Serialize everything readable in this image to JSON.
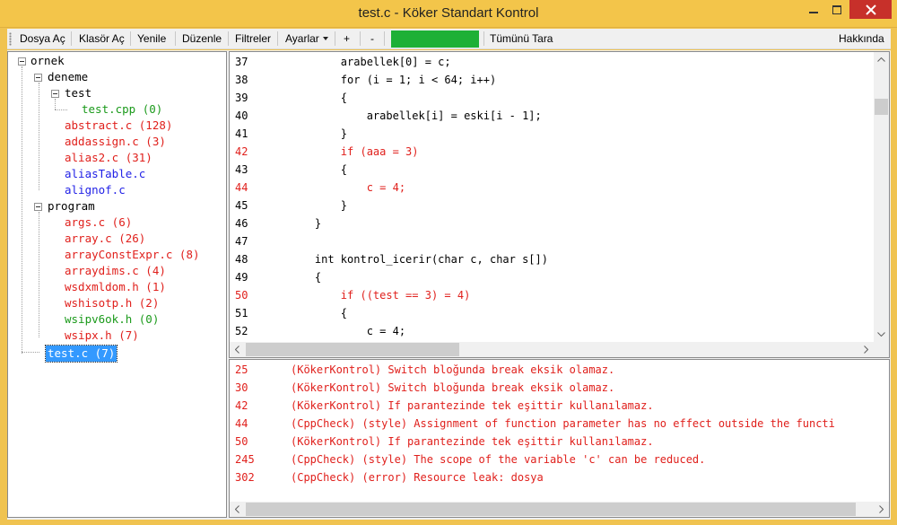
{
  "window": {
    "title": "test.c - Köker Standart Kontrol"
  },
  "colors": {
    "titlebar": "#f3c54a",
    "close": "#c7302a",
    "error_text": "#e0201c",
    "status_block": "#1eb036",
    "selection": "#3399ff"
  },
  "toolbar": {
    "open_file": "Dosya Aç",
    "open_folder": "Klasör Aç",
    "refresh": "Yenile",
    "edit": "Düzenle",
    "filters": "Filtreler",
    "settings": "Ayarlar",
    "plus": "+",
    "minus": "-",
    "scan_all": "Tümünü Tara",
    "about": "Hakkında"
  },
  "tree": {
    "root": "ornek",
    "deneme": "deneme",
    "test_folder": "test",
    "test_cpp": "test.cpp (0)",
    "abstract_c": "abstract.c (128)",
    "addassign_c": "addassign.c (3)",
    "alias2_c": "alias2.c (31)",
    "aliasTable_c": "aliasTable.c",
    "alignof_c": "alignof.c",
    "program": "program",
    "args_c": "args.c (6)",
    "array_c": "array.c (26)",
    "arrayConstExpr_c": "arrayConstExpr.c (8)",
    "arraydims_c": "arraydims.c (4)",
    "wsdxmldom_h": "wsdxmldom.h (1)",
    "wshisotp_h": "wshisotp.h (2)",
    "wsipv6ok_h": "wsipv6ok.h (0)",
    "wsipx_h": "wsipx.h (7)",
    "test_c": "test.c (7)"
  },
  "code": {
    "lines": [
      {
        "num": "37",
        "text": "        arabellek[0] = c;",
        "error": false
      },
      {
        "num": "38",
        "text": "        for (i = 1; i < 64; i++)",
        "error": false
      },
      {
        "num": "39",
        "text": "        {",
        "error": false
      },
      {
        "num": "40",
        "text": "            arabellek[i] = eski[i - 1];",
        "error": false
      },
      {
        "num": "41",
        "text": "        }",
        "error": false
      },
      {
        "num": "42",
        "text": "        if (aaa = 3)",
        "error": true
      },
      {
        "num": "43",
        "text": "        {",
        "error": false
      },
      {
        "num": "44",
        "text": "            c = 4;",
        "error": true
      },
      {
        "num": "45",
        "text": "        }",
        "error": false
      },
      {
        "num": "46",
        "text": "    }",
        "error": false
      },
      {
        "num": "47",
        "text": "",
        "error": false
      },
      {
        "num": "48",
        "text": "    int kontrol_icerir(char c, char s[])",
        "error": false
      },
      {
        "num": "49",
        "text": "    {",
        "error": false
      },
      {
        "num": "50",
        "text": "        if ((test == 3) = 4)",
        "error": true
      },
      {
        "num": "51",
        "text": "        {",
        "error": false
      },
      {
        "num": "52",
        "text": "            c = 4;",
        "error": false
      }
    ]
  },
  "messages": [
    {
      "line": "25",
      "text": "(KökerKontrol) Switch bloğunda break eksik olamaz."
    },
    {
      "line": "30",
      "text": "(KökerKontrol) Switch bloğunda break eksik olamaz."
    },
    {
      "line": "42",
      "text": "(KökerKontrol) If parantezinde tek eşittir kullanılamaz."
    },
    {
      "line": "44",
      "text": "(CppCheck) (style) Assignment of function parameter has no effect outside the functi"
    },
    {
      "line": "50",
      "text": "(KökerKontrol) If parantezinde tek eşittir kullanılamaz."
    },
    {
      "line": "245",
      "text": "(CppCheck) (style) The scope of the variable 'c' can be reduced."
    },
    {
      "line": "302",
      "text": "(CppCheck) (error) Resource leak: dosya"
    }
  ]
}
